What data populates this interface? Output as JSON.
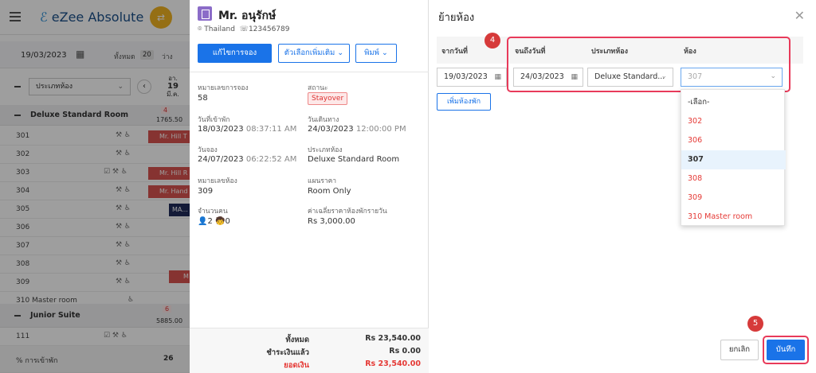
{
  "app": {
    "logo_text": "eZee Absolute",
    "date": "19/03/2023",
    "all_label": "ทั้งหมด",
    "all_count": "20",
    "empty_label": "ว่าง",
    "room_type_select": "ประเภทห้อง",
    "day_abbr": "อา.",
    "day_num": "19",
    "month_abbr": "มี.ค.",
    "groups": [
      {
        "name": "Deluxe Standard Room",
        "avail": "4",
        "rate": "1765.50"
      },
      {
        "name": "Junior Suite",
        "avail": "6",
        "rate": "5885.00"
      }
    ],
    "rooms": [
      "301",
      "302",
      "303",
      "304",
      "305",
      "306",
      "307",
      "308",
      "309",
      "310 Master room"
    ],
    "junior_rooms": [
      "111"
    ],
    "occupancy_label": "% การเข้าพัก",
    "occupancy_value": "26",
    "bookings": [
      "Mr. Hill T",
      "Mr. Hill R",
      "Mr. Hand",
      "MA...",
      "M"
    ]
  },
  "reservation": {
    "guest_name": "Mr. อนุรักษ์",
    "country": "Thailand",
    "phone": "123456789",
    "edit_button": "แก้ไขการจอง",
    "more_options_button": "ตัวเลือกเพิ่มเติม",
    "print_button": "พิมพ์",
    "booking_no_label": "หมายเลขการจอง",
    "booking_no": "58",
    "status_label": "สถานะ",
    "status": "Stayover",
    "checkin_label": "วันที่เข้าพัก",
    "checkin_date": "18/03/2023",
    "checkin_time": "08:37:11 AM",
    "departure_label": "วันเดินทาง",
    "departure_date": "24/03/2023",
    "departure_time": "12:00:00 PM",
    "booked_label": "วันจอง",
    "booked_date": "24/07/2023",
    "booked_time": "06:22:52 AM",
    "room_type_label": "ประเภทห้อง",
    "room_type": "Deluxe Standard Room",
    "room_no_label": "หมายเลขห้อง",
    "room_no": "309",
    "rate_plan_label": "แผนราคา",
    "rate_plan": "Room Only",
    "pax_label": "จำนวนคน",
    "adults": "2",
    "children": "0",
    "avg_rate_label": "ค่าเฉลี่ยราคาห้องพักรายวัน",
    "avg_rate": "Rs 3,000.00",
    "total_label": "ทั้งหมด",
    "total": "Rs 23,540.00",
    "paid_label": "ชำระเงินแล้ว",
    "paid": "Rs 0.00",
    "balance_label": "ยอดเงิน",
    "balance": "Rs 23,540.00"
  },
  "move_room": {
    "title": "ย้ายห้อง",
    "col_from": "จากวันที่",
    "col_to": "จนถึงวันที่",
    "col_room_type": "ประเภทห้อง",
    "col_room": "ห้อง",
    "from_date": "19/03/2023",
    "to_date": "24/03/2023",
    "room_type_value": "Deluxe Standard...",
    "room_value": "307",
    "add_room_button": "เพิ่มห้องพัก",
    "step4": "4",
    "step5": "5",
    "dropdown_options": [
      {
        "label": "-เลือก-",
        "color": "#333333"
      },
      {
        "label": "302",
        "color": "#e53935"
      },
      {
        "label": "306",
        "color": "#e53935"
      },
      {
        "label": "307",
        "color": "#333333",
        "selected": true
      },
      {
        "label": "308",
        "color": "#e53935"
      },
      {
        "label": "309",
        "color": "#e53935"
      },
      {
        "label": "310 Master room",
        "color": "#e53935"
      }
    ],
    "cancel_button": "ยกเลิก",
    "save_button": "บันทึก"
  }
}
